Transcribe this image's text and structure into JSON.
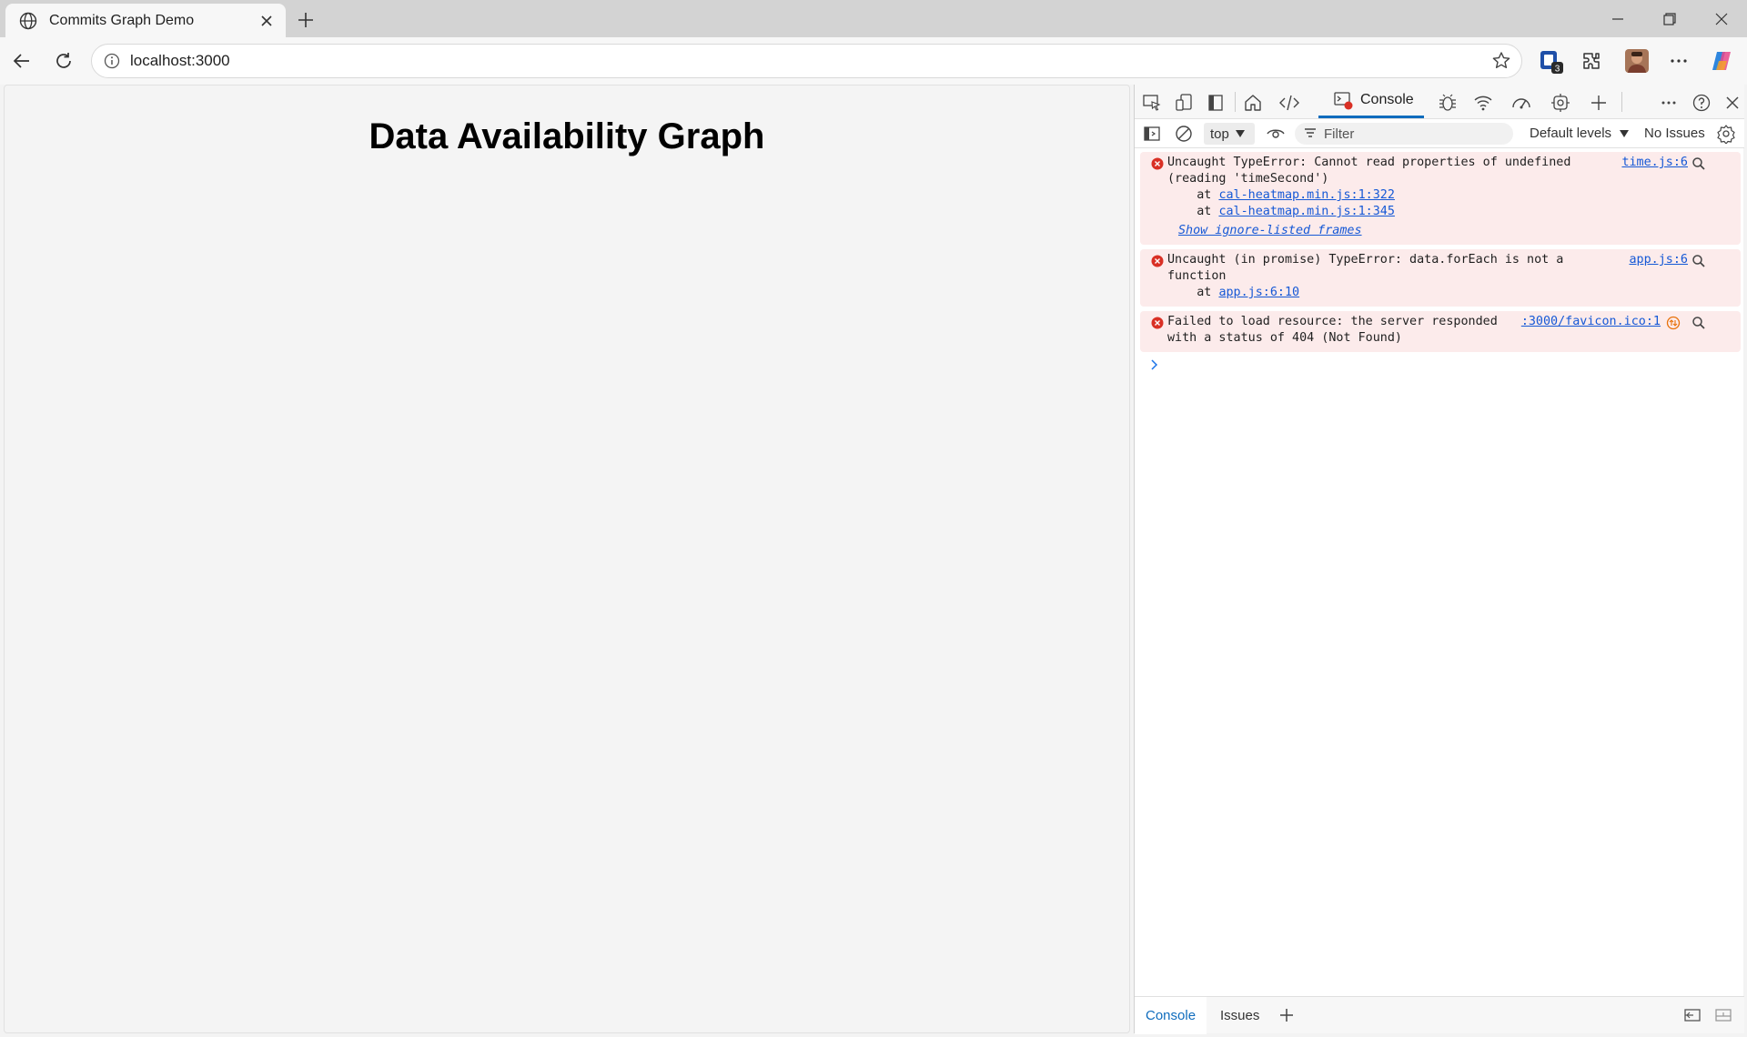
{
  "browser": {
    "tab_title": "Commits Graph Demo",
    "url": "localhost:3000",
    "extension_badge": "3"
  },
  "page": {
    "heading": "Data Availability Graph"
  },
  "devtools": {
    "active_tab": "Console",
    "context": "top",
    "filter_placeholder": "Filter",
    "levels": "Default levels",
    "issues": "No Issues",
    "messages": [
      {
        "lines": [
          "Uncaught TypeError: Cannot read properties of undefined",
          "(reading 'timeSecond')"
        ],
        "source": "time.js:6",
        "stack": [
          "cal-heatmap.min.js:1:322",
          "cal-heatmap.min.js:1:345"
        ],
        "footer": "Show ignore-listed frames"
      },
      {
        "lines": [
          "Uncaught (in promise) TypeError: data.forEach is not a",
          "function"
        ],
        "source": "app.js:6",
        "stack": [
          "app.js:6:10"
        ]
      },
      {
        "lines": [
          "Failed to load resource: the server responded",
          "with a status of 404 (Not Found)"
        ],
        "source": ":3000/favicon.ico:1"
      }
    ],
    "stack_prefix": "    at ",
    "drawer_tabs": [
      "Console",
      "Issues"
    ]
  },
  "colors": {
    "error_bg": "#fcebeb",
    "error_icon": "#d93025",
    "accent": "#0f6cbd",
    "link": "#1558d6"
  }
}
